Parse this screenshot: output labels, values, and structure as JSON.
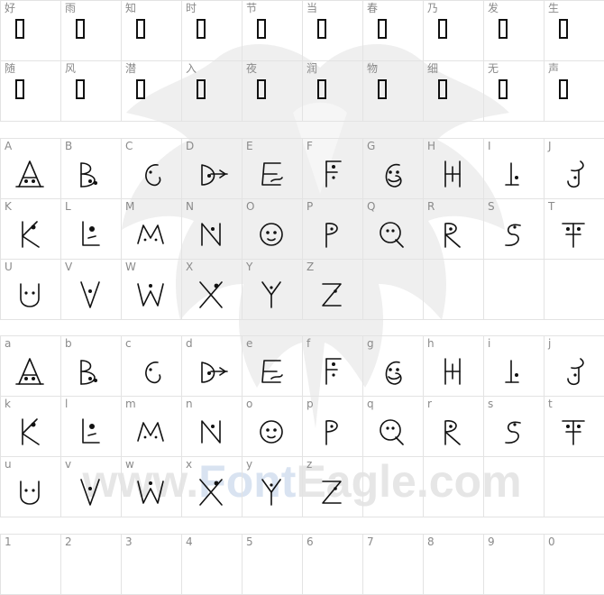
{
  "sections": [
    {
      "name": "chinese",
      "rows": [
        [
          "好",
          "雨",
          "知",
          "时",
          "节",
          "当",
          "春",
          "乃",
          "发",
          "生"
        ],
        [
          "随",
          "风",
          "潜",
          "入",
          "夜",
          "润",
          "物",
          "细",
          "无",
          "声"
        ]
      ]
    },
    {
      "name": "uppercase",
      "rows": [
        [
          "A",
          "B",
          "C",
          "D",
          "E",
          "F",
          "G",
          "H",
          "I",
          "J"
        ],
        [
          "K",
          "L",
          "M",
          "N",
          "O",
          "P",
          "Q",
          "R",
          "S",
          "T"
        ],
        [
          "U",
          "V",
          "W",
          "X",
          "Y",
          "Z",
          "",
          "",
          "",
          ""
        ]
      ]
    },
    {
      "name": "lowercase",
      "rows": [
        [
          "a",
          "b",
          "c",
          "d",
          "e",
          "f",
          "g",
          "h",
          "i",
          "j"
        ],
        [
          "k",
          "l",
          "m",
          "n",
          "o",
          "p",
          "q",
          "r",
          "s",
          "t"
        ],
        [
          "u",
          "v",
          "w",
          "x",
          "y",
          "z",
          "",
          "",
          "",
          ""
        ]
      ]
    },
    {
      "name": "digits",
      "rows": [
        [
          "1",
          "2",
          "3",
          "4",
          "5",
          "6",
          "7",
          "8",
          "9",
          "0"
        ]
      ]
    }
  ],
  "watermark": {
    "brand_left": "www.",
    "brand_mid": "Font",
    "brand_right": "Eagle.com"
  },
  "colors": {
    "grid": "#e3e3e3",
    "label": "#8a8a8a",
    "glyph": "#111111",
    "watermark": "#e6e6e6"
  }
}
